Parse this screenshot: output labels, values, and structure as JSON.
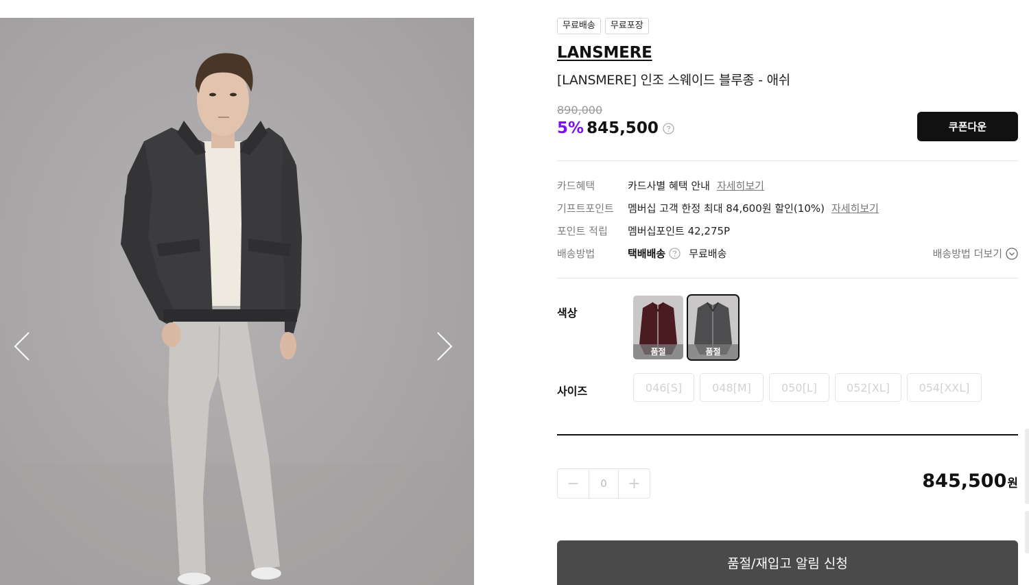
{
  "badges": [
    "무료배송",
    "무료포장"
  ],
  "product": {
    "brand": "LANSMERE",
    "name": "[LANSMERE] 인조 스웨이드 블루종 - 애쉬",
    "original_price": "890,000",
    "discount": "5%",
    "sale_price": "845,500",
    "coupon_button": "쿠폰다운"
  },
  "benefits": [
    {
      "label": "카드혜택",
      "value": "카드사별 혜택 안내",
      "link": "자세히보기"
    },
    {
      "label": "기프트포인트",
      "value": "멤버십 고객 한정 최대 84,600원 할인(10%)",
      "link": "자세히보기"
    },
    {
      "label": "포인트 적립",
      "value": "멤버십포인트 42,275P"
    }
  ],
  "shipping": {
    "label": "배송방법",
    "method": "택배배송",
    "fee": "무료배송",
    "more": "배송방법 더보기"
  },
  "options": {
    "color_label": "색상",
    "colors": [
      {
        "name": "burgundy",
        "color": "#4a1c22",
        "status": "품절",
        "selected": false
      },
      {
        "name": "ash",
        "color": "#4d4d4f",
        "status": "품절",
        "selected": true
      }
    ],
    "size_label": "사이즈",
    "sizes": [
      "046[S]",
      "048[M]",
      "050[L]",
      "052[XL]",
      "054[XXL]"
    ]
  },
  "quantity": {
    "value": "0",
    "minus": "−",
    "plus": "+"
  },
  "total": {
    "amount": "845,500",
    "unit": "원"
  },
  "notify_button": "품절/재입고 알림 신청",
  "colors": {
    "accent": "#7b10f0",
    "button_dark": "#111111",
    "notify_bg": "#4a4a4a"
  }
}
